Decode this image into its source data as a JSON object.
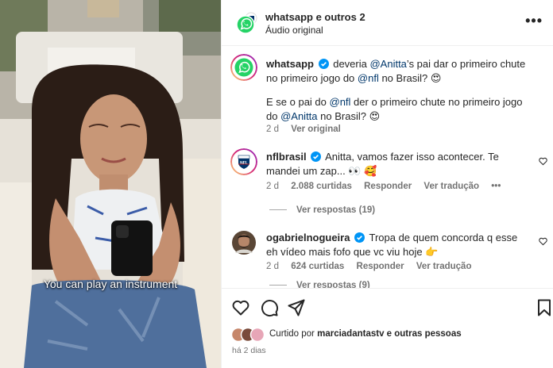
{
  "video": {
    "caption": "You can play an instrument"
  },
  "header": {
    "title": "whatsapp e outros 2",
    "subtitle": "Áudio original",
    "more_icon": "ellipsis-icon"
  },
  "comments": [
    {
      "username": "whatsapp",
      "verified": true,
      "text_before": "deveria ",
      "mention1": "@Anitta",
      "text_mid": "’s pai dar o primeiro chute no primeiro jogo do ",
      "mention2": "@nfl",
      "text_after": " no Brasil? 😍",
      "para2_before": "E se o pai do ",
      "para2_mention1": "@nfl",
      "para2_mid": " der o primeiro chute no primeiro jogo do ",
      "para2_mention2": "@Anitta",
      "para2_after": " no Brasil? 😍",
      "time": "2 d",
      "see_translation": "Ver original"
    },
    {
      "username": "nflbrasil",
      "verified": true,
      "text": "Anitta, vamos fazer isso acontecer. Te mandei um zap... 👀 🥰",
      "time": "2 d",
      "likes": "2.088 curtidas",
      "reply": "Responder",
      "see_translation": "Ver tradução",
      "more": "•••",
      "view_replies": "Ver respostas (19)"
    },
    {
      "username": "ogabrielnogueira",
      "verified": true,
      "text": "Tropa de quem concorda q esse eh vídeo mais fofo que vc viu hoje 👉",
      "time": "2 d",
      "likes": "624 curtidas",
      "reply": "Responder",
      "see_translation": "Ver tradução",
      "view_replies": "Ver respostas (9)"
    }
  ],
  "actions": {
    "like_icon": "heart-icon",
    "comment_icon": "comment-icon",
    "share_icon": "send-icon",
    "save_icon": "bookmark-icon",
    "liked_prefix": "Curtido por ",
    "liked_user": "marciadantastv",
    "liked_suffix": " e outras pessoas",
    "time_ago": "há 2 dias"
  },
  "colors": {
    "whatsapp_green": "#25d366",
    "verified_blue": "#0095f6",
    "mention": "#00376b",
    "meta_gray": "#737373"
  }
}
